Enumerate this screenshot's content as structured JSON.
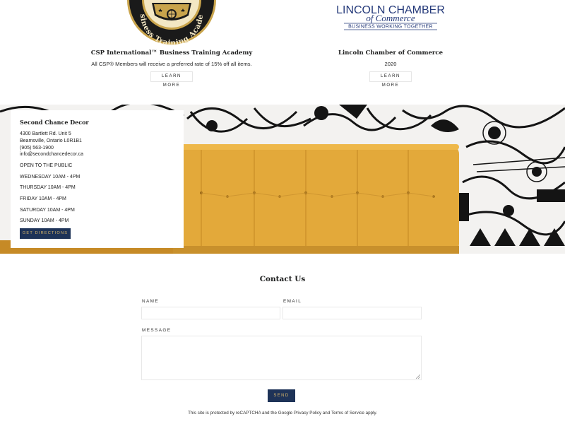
{
  "partners": [
    {
      "logo_text": "Business Training Academy",
      "name": "CSP International™ Business Training Academy",
      "description": "All CSP® Members will receive a preferred rate of 15% off all items.",
      "button": "LEARN MORE"
    },
    {
      "logo_line1": "LINCOLN CHAMBER",
      "logo_line2": "of Commerce",
      "logo_line3": "BUSINESS WORKING TOGETHER",
      "name": "Lincoln Chamber of Commerce",
      "description": "2020",
      "button": "LEARN MORE"
    }
  ],
  "store": {
    "name": "Second Chance Decor",
    "address_line1": "4300 Bartlett Rd. Unit 5",
    "address_line2": "Beamsville, Ontario L0R1B1",
    "phone": "(905) 563-1900",
    "email": "info@secondchancedecor.ca",
    "hours": [
      "OPEN TO THE PUBLIC",
      "WEDNESDAY 10AM - 4PM",
      "THURSDAY 10AM - 4PM",
      "FRIDAY 10AM - 4PM",
      "SATURDAY 10AM - 4PM",
      "SUNDAY 10AM - 4PM"
    ],
    "directions_button": "GET DIRECTIONS"
  },
  "contact": {
    "title": "Contact Us",
    "name_label": "NAME",
    "email_label": "EMAIL",
    "message_label": "MESSAGE",
    "send_button": "SEND",
    "recaptcha_notice": "This site is protected by reCAPTCHA and the Google Privacy Policy and Terms of Service apply."
  },
  "colors": {
    "navy": "#1e3358",
    "gold": "#d9b66a",
    "sofa": "#e3a93a"
  }
}
